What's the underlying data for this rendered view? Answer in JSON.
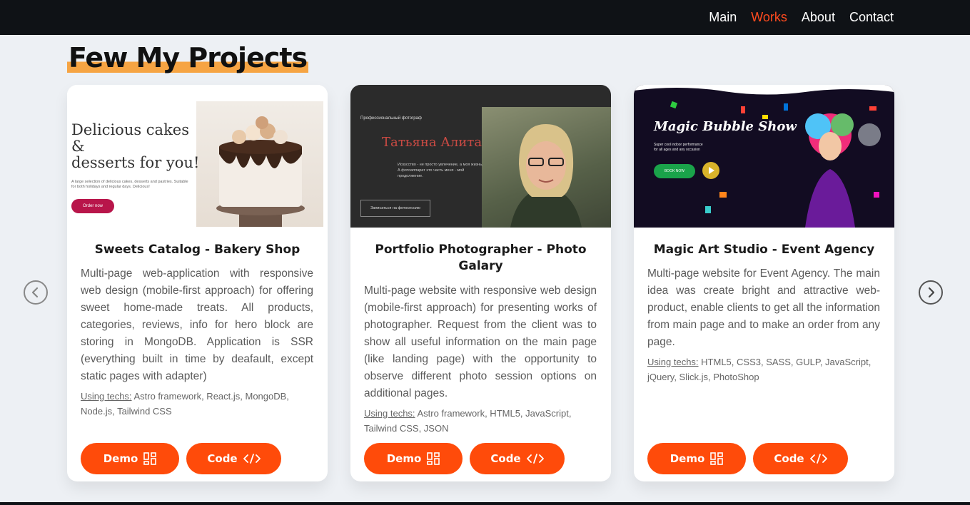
{
  "nav": {
    "items": [
      {
        "label": "Main",
        "active": false
      },
      {
        "label": "Works",
        "active": true
      },
      {
        "label": "About",
        "active": false
      },
      {
        "label": "Contact",
        "active": false
      }
    ]
  },
  "page": {
    "title": "Few My Projects"
  },
  "colors": {
    "accent": "#ff4b0a",
    "nav_active": "#ff4b1f",
    "heading_underline": "#f6a443",
    "topbar": "#0f1216",
    "background": "#edf0f4"
  },
  "carousel": {
    "prev_icon": "chevron-left-icon",
    "next_icon": "chevron-right-icon"
  },
  "projects": [
    {
      "title": "Sweets Catalog - Bakery Shop",
      "description": "Multi-page web-application with responsive web design (mobile-first approach) for offering sweet home-made treats. All products, categories, reviews, info for hero block are storing in MongoDB. Application is SSR (everything built in time by deafault, except static pages with adapter)",
      "techs_label": "Using techs:",
      "techs": "Astro framework, React.js, MongoDB, Node.js, Tailwind CSS",
      "demo_label": "Demo",
      "code_label": "Code",
      "demo_icon": "grid-icon",
      "code_icon": "code-icon",
      "thumbnail": {
        "heading_line1": "Delicious cakes",
        "heading_line2": "&",
        "heading_line3": "desserts for you!",
        "subtext": "A large selection of delicious cakes, desserts and pastries. Suitable for both holidays and regular days. Delicious!",
        "button": "Order now"
      }
    },
    {
      "title": "Portfolio Photographer - Photo Galary",
      "description": "Multi-page website with responsive web design (mobile-first approach) for presenting works of photographer. Request from the client was to show all useful information on the main page (like landing page) with the opportunity to observe different photo session options on additional pages.",
      "techs_label": "Using techs:",
      "techs": "Astro framework, HTML5, JavaScript, Tailwind CSS, JSON",
      "demo_label": "Demo",
      "code_label": "Code",
      "demo_icon": "grid-icon",
      "code_icon": "code-icon",
      "thumbnail": {
        "small_label": "Профессиональный фотограф",
        "name": "Татьяна Алита",
        "quote_line1": "Искусство - не просто увлечение, а моя жизнь.",
        "quote_line2": "А фотоаппарат это часть меня - мой продолжение.",
        "button": "Записаться на фотосессию"
      }
    },
    {
      "title": "Magic Art Studio - Event Agency",
      "description": "Multi-page website for Event Agency. The main idea was create bright and attractive web-product, enable clients to get all the information from main page and to make an order from any page.",
      "techs_label": "Using techs:",
      "techs": "HTML5, CSS3, SASS, GULP, JavaScript, jQuery, Slick.js, PhotoShop",
      "demo_label": "Demo",
      "code_label": "Code",
      "demo_icon": "grid-icon",
      "code_icon": "code-icon",
      "thumbnail": {
        "title": "Magic Bubble Show",
        "subtitle_line1": "Super cool indoor performance",
        "subtitle_line2": "for all ages and any occasion",
        "button": "BOOK NOW"
      }
    }
  ]
}
